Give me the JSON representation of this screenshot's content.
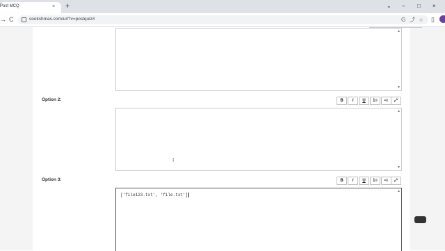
{
  "browser": {
    "tab_title": "Post MCQ",
    "tab_close": "×",
    "new_tab": "+",
    "window_controls": [
      "⌄",
      "–",
      "□",
      "×"
    ],
    "nav": {
      "back": "←",
      "forward": "→",
      "reload": "C"
    },
    "url": "sookshmas.com/url?v=postquiz#",
    "omnibox_icons": [
      "G",
      "⤴",
      "☆",
      "▯"
    ]
  },
  "form": {
    "option2": {
      "label": "Option 2:"
    },
    "option3": {
      "label": "Option 3:",
      "value": "['file123.txt', 'file.txt']"
    },
    "toolbar": [
      {
        "name": "bold-button",
        "label": "B"
      },
      {
        "name": "italic-button",
        "label": "I"
      },
      {
        "name": "underline-button",
        "label": "U"
      },
      {
        "name": "ordered-list-button",
        "label": "1≡"
      },
      {
        "name": "unordered-list-button",
        "label": "•≡"
      },
      {
        "name": "fullscreen-button",
        "label": "⤢"
      }
    ],
    "scroll_up": "▲",
    "scroll_down": "▼"
  }
}
